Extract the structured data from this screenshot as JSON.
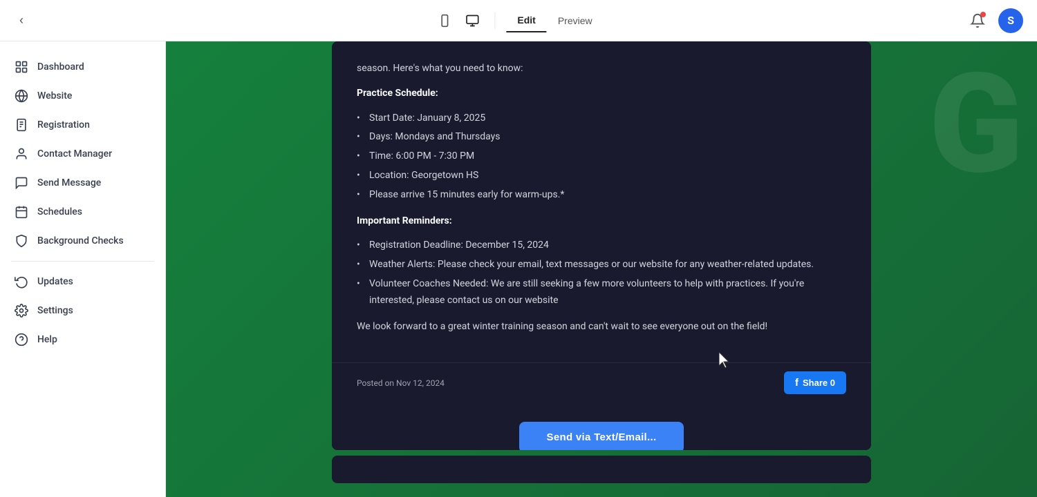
{
  "topbar": {
    "back_label": "‹",
    "tab_edit": "Edit",
    "tab_preview": "Preview",
    "avatar_letter": "S",
    "device_mobile_icon": "mobile",
    "device_desktop_icon": "desktop",
    "active_tab": "edit"
  },
  "sidebar": {
    "items": [
      {
        "id": "dashboard",
        "label": "Dashboard",
        "icon": "grid"
      },
      {
        "id": "website",
        "label": "Website",
        "icon": "globe"
      },
      {
        "id": "registration",
        "label": "Registration",
        "icon": "clipboard"
      },
      {
        "id": "contact-manager",
        "label": "Contact Manager",
        "icon": "person"
      },
      {
        "id": "send-message",
        "label": "Send Message",
        "icon": "message"
      },
      {
        "id": "schedules",
        "label": "Schedules",
        "icon": "calendar"
      },
      {
        "id": "background-checks",
        "label": "Background Checks",
        "icon": "shield"
      },
      {
        "id": "updates",
        "label": "Updates",
        "icon": "refresh"
      },
      {
        "id": "settings",
        "label": "Settings",
        "icon": "gear"
      },
      {
        "id": "help",
        "label": "Help",
        "icon": "question"
      }
    ]
  },
  "article": {
    "intro_text": "season. Here's what you need to know:",
    "practice_schedule_title": "Practice Schedule:",
    "practice_items": [
      "Start Date: January 8, 2025",
      "Days: Mondays and Thursdays",
      "Time: 6:00 PM - 7:30 PM",
      "Location: Georgetown HS",
      "Please arrive 15 minutes early for warm-ups.*"
    ],
    "reminders_title": "Important Reminders:",
    "reminder_items": [
      "Registration Deadline: December 15, 2024",
      "Weather Alerts: Please check your email, text messages or our website for any weather-related updates.",
      "Volunteer Coaches Needed: We are still seeking a few more volunteers to help with practices. If you're interested, please contact us on our website"
    ],
    "closing_text": "We look forward to a great winter training season and can't wait to see everyone out on the field!",
    "posted_date": "Posted on Nov 12, 2024",
    "fb_share_label": "Share 0",
    "send_button_label": "Send via Text/Email..."
  },
  "colors": {
    "bg_green": "#15803d",
    "card_dark": "#1a1a2e",
    "fb_blue": "#1877f2",
    "send_blue": "#3b82f6",
    "notif_red": "#ef4444",
    "avatar_blue": "#2563eb"
  }
}
